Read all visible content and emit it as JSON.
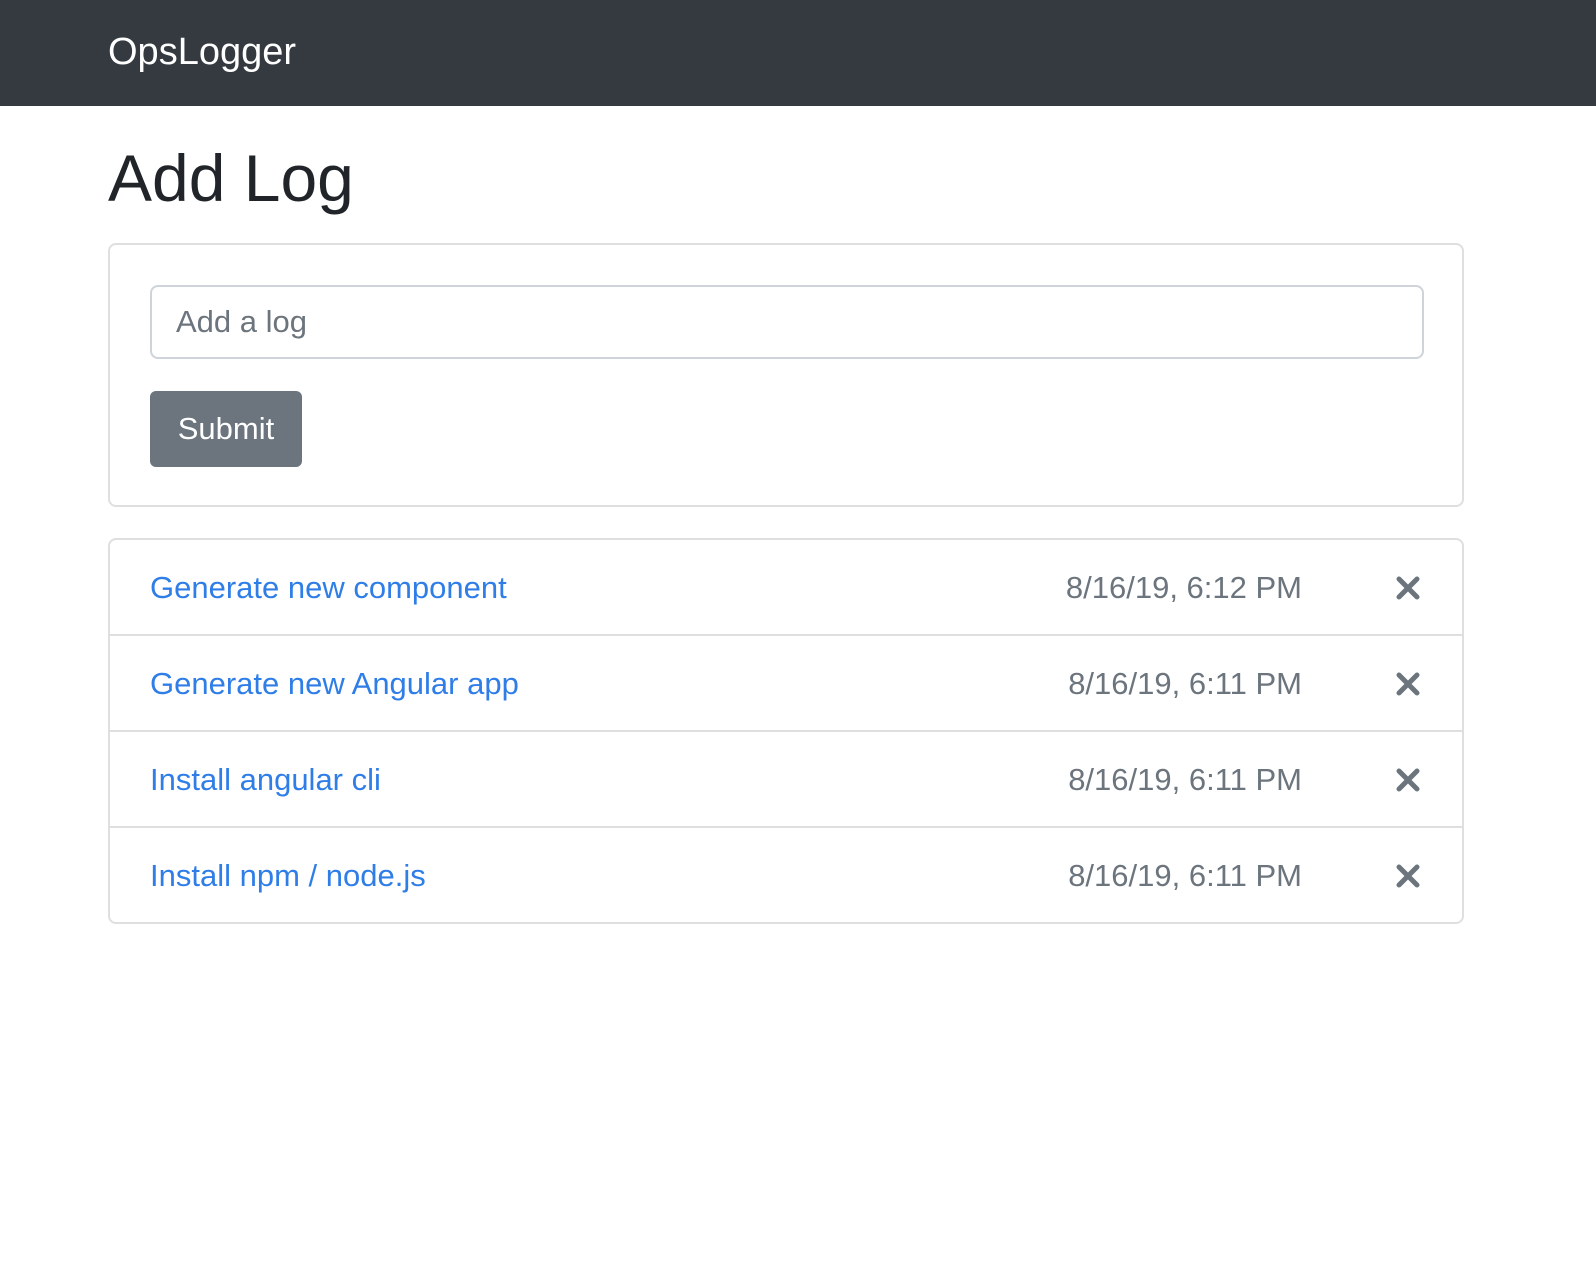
{
  "navbar": {
    "brand": "OpsLogger"
  },
  "page": {
    "title": "Add Log"
  },
  "form": {
    "input_value": "",
    "input_placeholder": "Add a log",
    "submit_label": "Submit"
  },
  "logs": [
    {
      "text": "Generate new component",
      "date": "8/16/19, 6:12 PM",
      "delete_icon": "close-icon"
    },
    {
      "text": "Generate new Angular app",
      "date": "8/16/19, 6:11 PM",
      "delete_icon": "close-icon"
    },
    {
      "text": "Install angular cli",
      "date": "8/16/19, 6:11 PM",
      "delete_icon": "close-icon"
    },
    {
      "text": "Install npm / node.js",
      "date": "8/16/19, 6:11 PM",
      "delete_icon": "close-icon"
    }
  ],
  "colors": {
    "navbar_bg": "#343a40",
    "link": "#2f7ee8",
    "muted": "#6c757d",
    "border": "#dfdfdf"
  }
}
